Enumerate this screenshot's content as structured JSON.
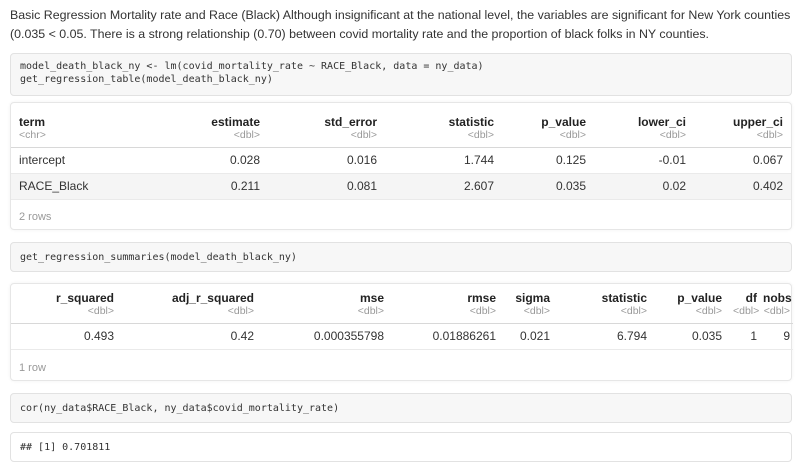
{
  "intro": {
    "text": "Basic Regression Mortality rate and Race (Black) Although insignificant at the national level, the variables are significant for New York counties (0.035 < 0.05. There is a strong relationship (0.70) between covid mortality rate and the proportion of black folks in NY counties."
  },
  "code1": {
    "line1": "model_death_black_ny <- lm(covid_mortality_rate ~ RACE_Black, data = ny_data)",
    "line2": "get_regression_table(model_death_black_ny)"
  },
  "table1": {
    "columns": [
      {
        "name": "term",
        "type": "<chr>"
      },
      {
        "name": "estimate",
        "type": "<dbl>"
      },
      {
        "name": "std_error",
        "type": "<dbl>"
      },
      {
        "name": "statistic",
        "type": "<dbl>"
      },
      {
        "name": "p_value",
        "type": "<dbl>"
      },
      {
        "name": "lower_ci",
        "type": "<dbl>"
      },
      {
        "name": "upper_ci",
        "type": "<dbl>"
      }
    ],
    "rows": [
      [
        "intercept",
        "0.028",
        "0.016",
        "1.744",
        "0.125",
        "-0.01",
        "0.067"
      ],
      [
        "RACE_Black",
        "0.211",
        "0.081",
        "2.607",
        "0.035",
        "0.02",
        "0.402"
      ]
    ],
    "footer": "2 rows"
  },
  "code2": {
    "line1": "get_regression_summaries(model_death_black_ny)"
  },
  "table2": {
    "columns": [
      {
        "name": "r_squared",
        "type": "<dbl>"
      },
      {
        "name": "adj_r_squared",
        "type": "<dbl>"
      },
      {
        "name": "mse",
        "type": "<dbl>"
      },
      {
        "name": "rmse",
        "type": "<dbl>"
      },
      {
        "name": "sigma",
        "type": "<dbl>"
      },
      {
        "name": "statistic",
        "type": "<dbl>"
      },
      {
        "name": "p_value",
        "type": "<dbl>"
      },
      {
        "name": "df",
        "type": "<dbl>"
      },
      {
        "name": "nobs",
        "type": "<dbl>"
      }
    ],
    "rows": [
      [
        "0.493",
        "0.42",
        "0.000355798",
        "0.01886261",
        "0.021",
        "6.794",
        "0.035",
        "1",
        "9"
      ]
    ],
    "footer": "1 row"
  },
  "code3": {
    "line1": "cor(ny_data$RACE_Black, ny_data$covid_mortality_rate)"
  },
  "output3": {
    "line1": "## [1] 0.701811"
  }
}
